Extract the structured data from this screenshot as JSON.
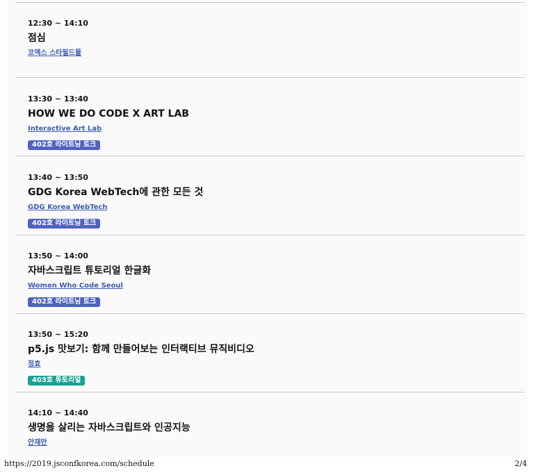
{
  "schedule": {
    "sessions": [
      {
        "time": "12:30 ~ 14:10",
        "title": "점심",
        "speaker": "코엑스 스타필드몰",
        "tag": null
      },
      {
        "time": "13:30 ~ 13:40",
        "title": "HOW WE DO CODE X ART LAB",
        "speaker": "Interactive Art Lab",
        "tag": "402호 라이트닝 토크"
      },
      {
        "time": "13:40 ~ 13:50",
        "title": "GDG Korea WebTech에 관한 모든 것",
        "speaker": "GDG Korea WebTech",
        "tag": "402호 라이트닝 토크"
      },
      {
        "time": "13:50 ~ 14:00",
        "title": "자바스크립트 튜토리얼 한글화",
        "speaker": "Women Who Code Seoul",
        "tag": "402호 라이트닝 토크"
      },
      {
        "time": "13:50 ~ 15:20",
        "title": "p5.js 맛보기: 함께 만들어보는 인터랙티브 뮤직비디오",
        "speaker": "정효",
        "tag": "403호 튜토리얼"
      },
      {
        "time": "14:10 ~ 14:40",
        "title": "생명을 살리는 자바스크립트와 인공지능",
        "speaker": "안재만",
        "tag": null
      }
    ]
  },
  "colors": {
    "lightning_tag": "#4f62c0",
    "tutorial_tag": "#16a293",
    "link": "#3b5bb5"
  },
  "footer": {
    "url": "https://2019.jsconfkorea.com/schedule",
    "page": "2/4"
  }
}
